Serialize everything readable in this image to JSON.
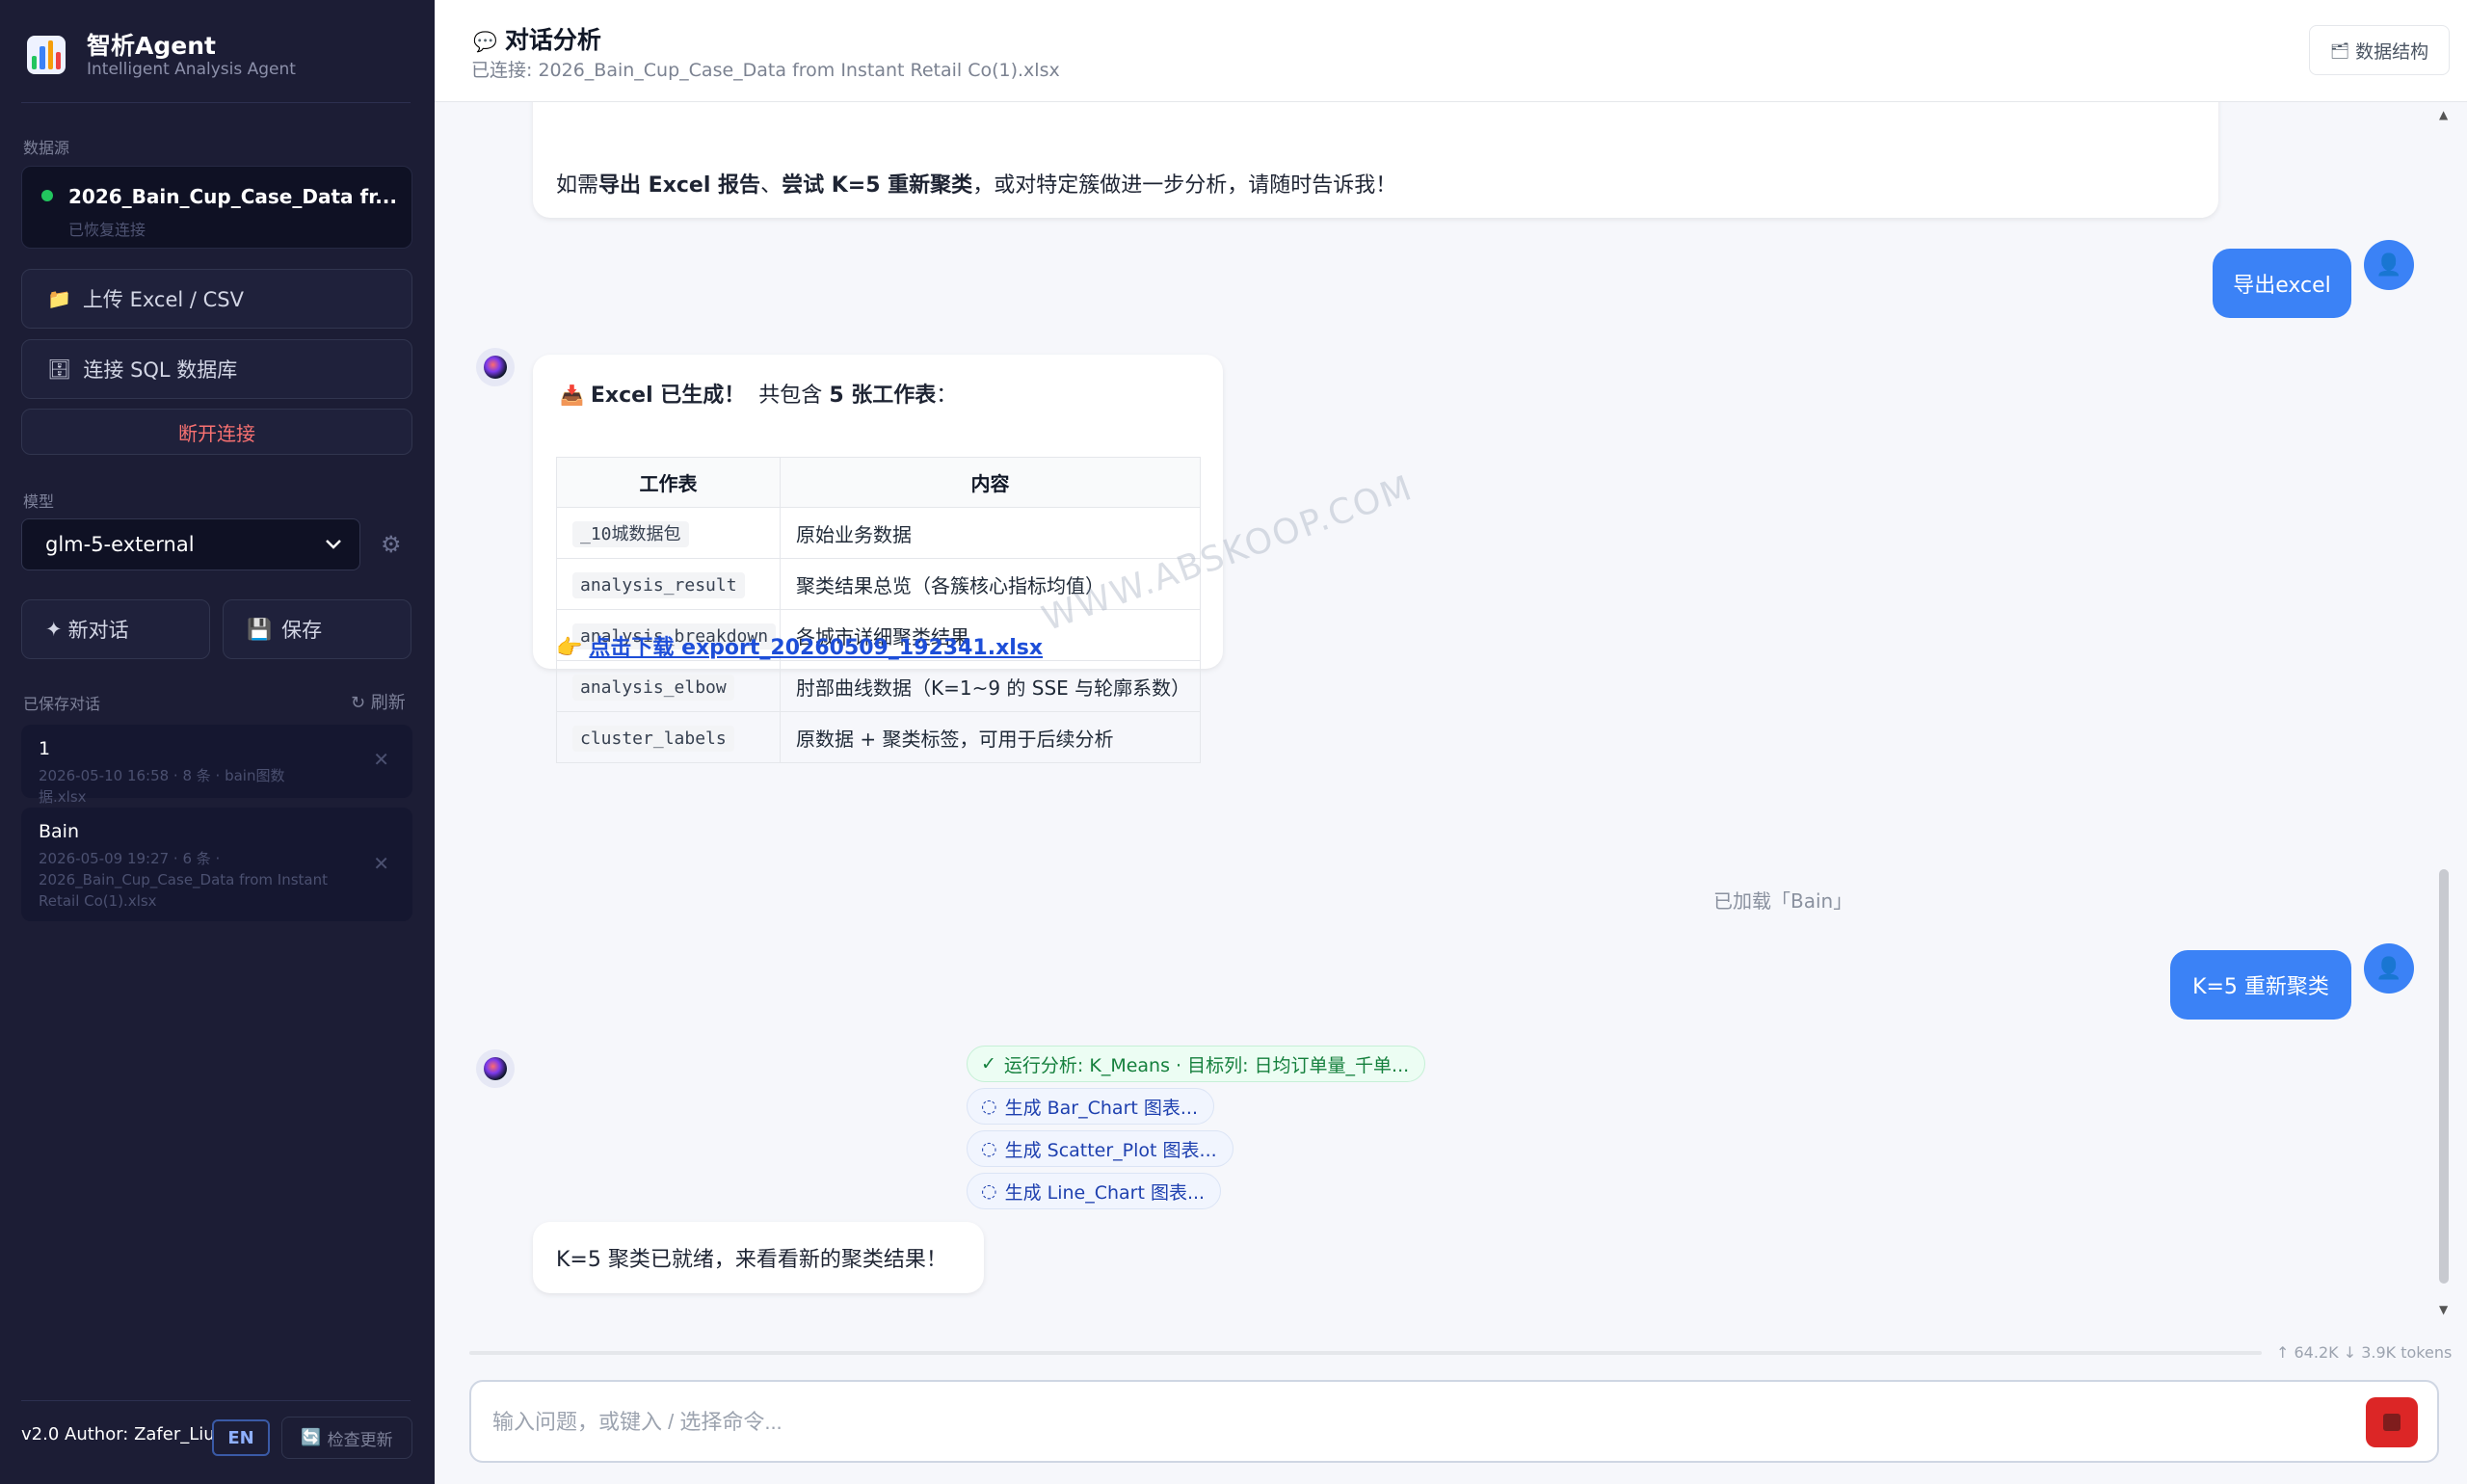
{
  "app": {
    "name": "智析Agent",
    "subtitle": "Intelligent Analysis Agent"
  },
  "sidebar": {
    "datasource_label": "数据源",
    "datasource": {
      "name": "2026_Bain_Cup_Case_Data fr...",
      "status": "已恢复连接",
      "status_color": "#22c55e"
    },
    "upload_label": "上传 Excel / CSV",
    "sql_label": "连接 SQL 数据库",
    "disconnect_label": "断开连接",
    "model_label": "模型",
    "model_value": "glm-5-external",
    "new_chat_label": "新对话",
    "save_label": "保存",
    "saved_label": "已保存对话",
    "refresh_label": "↻ 刷新",
    "conversations": [
      {
        "title": "1",
        "meta": "2026-05-10 16:58 · 8 条 · bain图数据.xlsx"
      },
      {
        "title": "Bain",
        "meta": "2026-05-09 19:27 · 6 条 · 2026_Bain_Cup_Case_Data from Instant Retail Co(1).xlsx"
      }
    ],
    "footer": {
      "version": "v2.0 Author: Zafer_Liu",
      "lang": "EN",
      "update": "检查更新"
    }
  },
  "header": {
    "icon": "speech-bubble-icon",
    "title": "对话分析",
    "connection": "已连接: 2026_Bain_Cup_Case_Data from Instant Retail Co(1).xlsx",
    "schema_button": "数据结构"
  },
  "messages": {
    "prev_tail": {
      "t1": "如需",
      "b1": "导出 Excel 报告",
      "t2": "、",
      "b2": "尝试 K=5 重新聚类",
      "t3": "，或对特定簇做进一步分析，请随时告诉我！"
    },
    "user_export": "导出excel",
    "excel": {
      "icon": "inbox-tray-icon",
      "heading": "Excel 已生成！",
      "mid": "共包含",
      "count": "5 张工作表",
      "colon": "：",
      "columns": [
        "工作表",
        "内容"
      ],
      "rows": [
        [
          "_10城数据包",
          "原始业务数据"
        ],
        [
          "analysis_result",
          "聚类结果总览（各簇核心指标均值）"
        ],
        [
          "analysis_breakdown",
          "各城市详细聚类结果"
        ],
        [
          "analysis_elbow",
          "肘部曲线数据（K=1~9 的 SSE 与轮廓系数）"
        ],
        [
          "cluster_labels",
          "原数据 + 聚类标签，可用于后续分析"
        ]
      ],
      "link_icon": "pointing-hand-icon",
      "link": "点击下载 export_20260509_192341.xlsx"
    },
    "system_note": "已加载「Bain」",
    "user_k5": "K=5 重新聚类",
    "steps": [
      {
        "icon": "check-icon",
        "text": "运行分析: K_Means · 目标列: 日均订单量_千单...",
        "state": "done"
      },
      {
        "icon": "spinner-icon",
        "text": "生成 Bar_Chart 图表...",
        "state": "pending"
      },
      {
        "icon": "spinner-icon",
        "text": "生成 Scatter_Plot 图表...",
        "state": "pending"
      },
      {
        "icon": "spinner-icon",
        "text": "生成 Line_Chart 图表...",
        "state": "pending"
      }
    ],
    "bot_reply": "K=5 聚类已就绪，来看看新的聚类结果！",
    "watermark": "WWW.ABSKOOP.COM"
  },
  "input": {
    "tokens": "↑ 64.2K ↓ 3.9K tokens",
    "placeholder": "输入问题，或键入 / 选择命令...",
    "value": ""
  },
  "colors": {
    "sidebar_bg": "#1c1d35",
    "accent": "#3b82f6",
    "danger": "#dc2626",
    "success": "#22c55e"
  }
}
